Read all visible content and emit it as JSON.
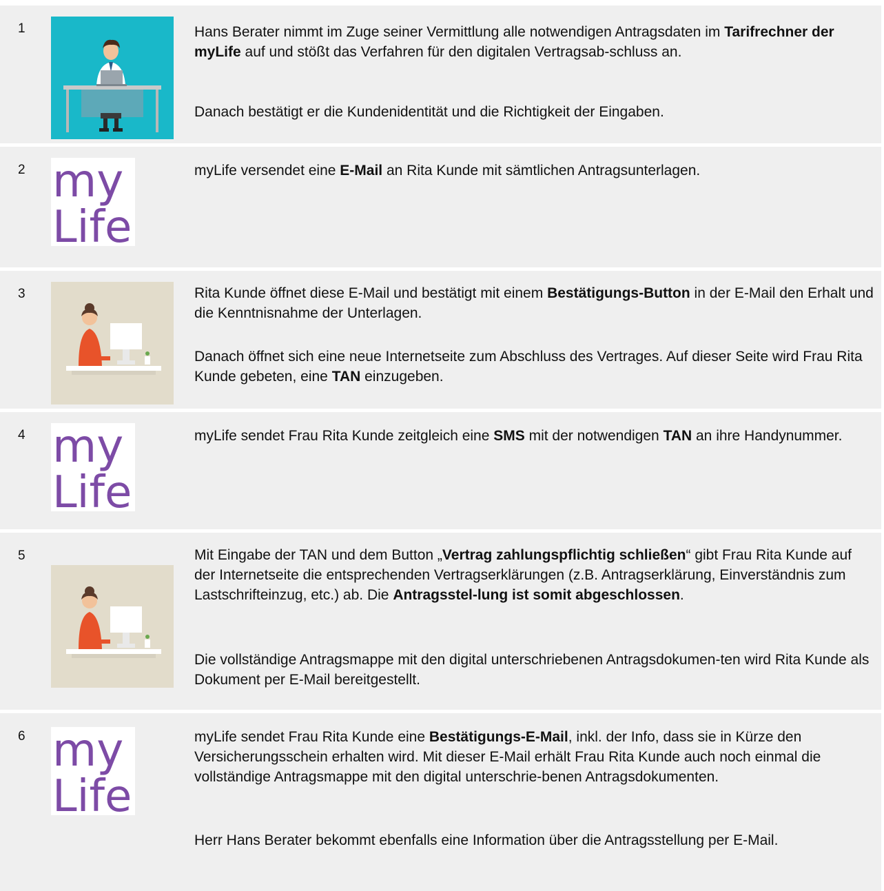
{
  "steps": [
    {
      "number": "1",
      "image": "consultant-illustration",
      "paragraphs": [
        [
          "Hans Berater nimmt im Zuge seiner Vermittlung alle notwendigen Antragsdaten im ",
          {
            "b": "Tarifrechner der myLife"
          },
          " auf und stößt das Verfahren für den digitalen Vertragsab-schluss an."
        ],
        [
          "Danach bestätigt er die Kundenidentität und die Richtigkeit der Eingaben."
        ]
      ]
    },
    {
      "number": "2",
      "image": "mylife-logo",
      "paragraphs": [
        [
          "myLife versendet eine ",
          {
            "b": "E-Mail"
          },
          " an Rita Kunde mit sämtlichen Antragsunterlagen."
        ]
      ]
    },
    {
      "number": "3",
      "image": "customer-illustration",
      "paragraphs": [
        [
          "Rita Kunde öffnet diese E-Mail und bestätigt mit einem ",
          {
            "b": "Bestätigungs-Button"
          },
          " in der E-Mail den Erhalt und die Kenntnisnahme der Unterlagen."
        ],
        [
          "Danach öffnet sich eine neue Internetseite zum Abschluss des Vertrages. Auf dieser Seite wird Frau Rita Kunde gebeten, eine ",
          {
            "b": "TAN"
          },
          " einzugeben."
        ]
      ]
    },
    {
      "number": "4",
      "image": "mylife-logo",
      "paragraphs": [
        [
          "myLife sendet Frau Rita Kunde zeitgleich eine ",
          {
            "b": "SMS"
          },
          " mit der notwendigen ",
          {
            "b": "TAN"
          },
          " an ihre Handynummer."
        ]
      ]
    },
    {
      "number": "5",
      "image": "customer-illustration",
      "paragraphs": [
        [
          "Mit Eingabe der TAN und dem Button „",
          {
            "b": "Vertrag zahlungspflichtig schließen"
          },
          "“ gibt Frau Rita Kunde auf der Internetseite die entsprechenden Vertragserklärungen (z.B. Antragserklärung, Einverständnis zum Lastschrifteinzug, etc.) ab. Die ",
          {
            "b": "Antragsstel-lung ist somit abgeschlossen"
          },
          "."
        ],
        [
          "Die vollständige Antragsmappe mit den digital unterschriebenen Antragsdokumen-ten wird Rita Kunde als Dokument per E-Mail bereitgestellt."
        ]
      ]
    },
    {
      "number": "6",
      "image": "mylife-logo",
      "paragraphs": [
        [
          "myLife sendet Frau Rita Kunde eine ",
          {
            "b": "Bestätigungs-E-Mail"
          },
          ", inkl. der Info, dass sie in Kürze den Versicherungsschein erhalten wird. Mit dieser E-Mail erhält Frau Rita Kunde auch noch einmal die vollständige Antragsmappe mit den digital unterschrie-benen Antragsdokumenten."
        ],
        [
          "Herr Hans Berater bekommt ebenfalls eine Information über die Antragsstellung per E-Mail."
        ]
      ]
    }
  ],
  "logo_text": {
    "top": "my",
    "bottom": "Life"
  },
  "colors": {
    "row_bg": "#efefef",
    "logo_purple": "#7d4ba6",
    "teal": "#19b8c9",
    "beige": "#e2dccb"
  }
}
